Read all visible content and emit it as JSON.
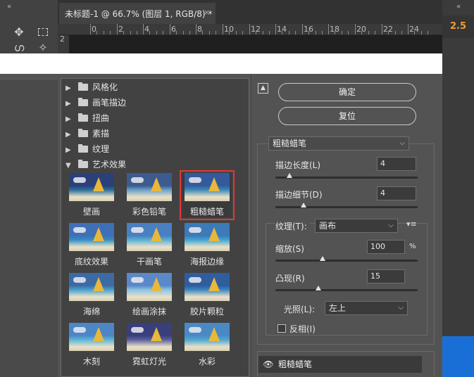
{
  "document_tab": {
    "title": "未标题-1 @ 66.7% (图层 1, RGB/8) *",
    "close": "×"
  },
  "panel_collapse": "«",
  "ruler": {
    "h_labels": [
      "0",
      "2",
      "4",
      "6",
      "8",
      "10",
      "12",
      "14",
      "16",
      "18",
      "20",
      "22",
      "24"
    ],
    "v_label": "2"
  },
  "options_value": "2.5",
  "filter_categories": [
    {
      "label": "风格化",
      "expanded": false
    },
    {
      "label": "画笔描边",
      "expanded": false
    },
    {
      "label": "扭曲",
      "expanded": false
    },
    {
      "label": "素描",
      "expanded": false
    },
    {
      "label": "纹理",
      "expanded": false
    },
    {
      "label": "艺术效果",
      "expanded": true
    }
  ],
  "filter_thumbs": [
    {
      "label": "壁画",
      "selected": false
    },
    {
      "label": "彩色铅笔",
      "selected": false
    },
    {
      "label": "粗糙蜡笔",
      "selected": true
    },
    {
      "label": "底纹效果",
      "selected": false
    },
    {
      "label": "干画笔",
      "selected": false
    },
    {
      "label": "海报边缘",
      "selected": false
    },
    {
      "label": "海绵",
      "selected": false
    },
    {
      "label": "绘画涂抹",
      "selected": false
    },
    {
      "label": "胶片颗粒",
      "selected": false
    },
    {
      "label": "木刻",
      "selected": false
    },
    {
      "label": "霓虹灯光",
      "selected": false
    },
    {
      "label": "水彩",
      "selected": false
    }
  ],
  "buttons": {
    "ok": "确定",
    "reset": "复位"
  },
  "settings": {
    "filter_select": "粗糙蜡笔",
    "stroke_length": {
      "label": "描边长度(L)",
      "value": "4",
      "fraction": 0.1
    },
    "stroke_detail": {
      "label": "描边细节(D)",
      "value": "4",
      "fraction": 0.2
    },
    "texture": {
      "label": "纹理(T):",
      "value": "画布"
    },
    "scaling": {
      "label": "缩放(S)",
      "value": "100",
      "unit": "%",
      "fraction": 0.33
    },
    "relief": {
      "label": "凸现(R)",
      "value": "15",
      "fraction": 0.3
    },
    "light": {
      "label": "光照(L):",
      "value": "左上"
    },
    "invert": {
      "label": "反相(I)",
      "checked": false
    }
  },
  "effect_layer": {
    "label": "粗糙蜡笔"
  }
}
